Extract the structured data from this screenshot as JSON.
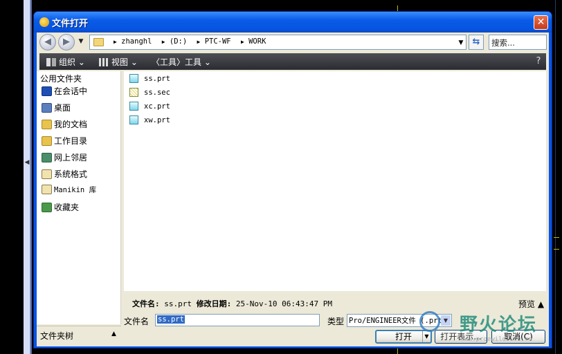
{
  "dialog": {
    "title": "文件打开",
    "close_label": "✕"
  },
  "nav": {
    "back_glyph": "◀",
    "forward_glyph": "▶",
    "breadcrumbs": [
      "zhanghl",
      "(D:)",
      "PTC-WF",
      "WORK"
    ],
    "search_placeholder": "搜索..."
  },
  "toolbar": {
    "organize": "组织",
    "views": "视图",
    "tools_bracket": "〈工具〉",
    "tools": "工具",
    "organize_icon": "organize-icon",
    "views_icon": "views-icon"
  },
  "sidebar": {
    "title": "公用文件夹",
    "items": [
      {
        "label": "在会话中",
        "icon": "session-icon",
        "color": "#1f4fb5"
      },
      {
        "label": "桌面",
        "icon": "desktop-icon",
        "color": "#5b7fbd"
      },
      {
        "label": "我的文档",
        "icon": "my-documents-icon",
        "color": "#e8c34d"
      },
      {
        "label": "工作目录",
        "icon": "working-directory-icon",
        "color": "#e8c34d"
      },
      {
        "label": "网上邻居",
        "icon": "network-icon",
        "color": "#4a8f6a"
      },
      {
        "label": "系统格式",
        "icon": "system-formats-icon",
        "color": "#b7a36a"
      },
      {
        "label": "Manikin 库",
        "icon": "manikin-library-icon",
        "color": "#b7a36a"
      },
      {
        "label": "收藏夹",
        "icon": "favorites-icon",
        "color": "#4b9a4b"
      }
    ],
    "tree_label": "文件夹树",
    "tree_arrow": "▲"
  },
  "files": [
    {
      "name": "ss.prt",
      "type": "prt"
    },
    {
      "name": "ss.sec",
      "type": "sec"
    },
    {
      "name": "xc.prt",
      "type": "prt"
    },
    {
      "name": "xw.prt",
      "type": "prt"
    }
  ],
  "details": {
    "filename_label": "文件名:",
    "filename_value": "ss.prt",
    "modified_label": "修改日期:",
    "modified_value": "25-Nov-10 06:43:47 PM",
    "preview_label": "预览 ▲"
  },
  "form": {
    "filename_label": "文件名",
    "filename_value": "ss.prt",
    "type_label": "类型",
    "type_value": "Pro/ENGINEER文件 (.prt)",
    "open_label": "打开",
    "open_split": "▼",
    "open_display_label": "打开表示...",
    "cancel_label": "取消(C)"
  },
  "watermark": {
    "text": "野火论坛",
    "url": "www.proewildfire.cn"
  }
}
